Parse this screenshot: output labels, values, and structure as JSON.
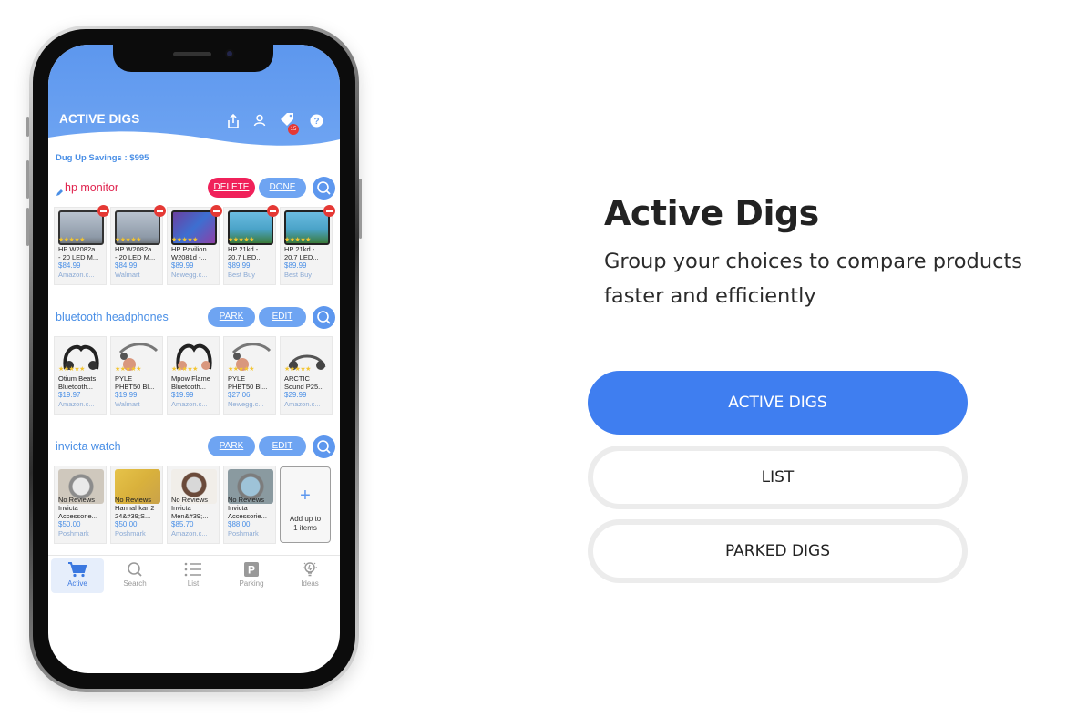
{
  "app": {
    "title": "ACTIVE DIGS",
    "notification_count": "15",
    "savings_text": "Dug Up Savings : $995"
  },
  "digs": [
    {
      "title": "hp monitor",
      "edit_icon": "pencil-icon",
      "buttons": [
        "DELETE",
        "DONE"
      ],
      "items": [
        {
          "name1": "HP W2082a",
          "name2": "- 20 LED M...",
          "price": "$84.99",
          "store": "Amazon.c..."
        },
        {
          "name1": "HP W2082a",
          "name2": "- 20 LED M...",
          "price": "$84.99",
          "store": "Walmart"
        },
        {
          "name1": "HP Pavilion",
          "name2": "W2081d -...",
          "price": "$89.99",
          "store": "Newegg.c..."
        },
        {
          "name1": "HP 21kd -",
          "name2": "20.7 LED...",
          "price": "$89.99",
          "store": "Best Buy"
        },
        {
          "name1": "HP 21kd -",
          "name2": "20.7 LED...",
          "price": "$89.99",
          "store": "Best Buy"
        }
      ]
    },
    {
      "title": "bluetooth headphones",
      "buttons": [
        "PARK",
        "EDIT"
      ],
      "items": [
        {
          "name1": "Otium Beats",
          "name2": "Bluetooth...",
          "price": "$19.97",
          "store": "Amazon.c..."
        },
        {
          "name1": "PYLE",
          "name2": "PHBT50 Bl...",
          "price": "$19.99",
          "store": "Walmart"
        },
        {
          "name1": "Mpow Flame",
          "name2": "Bluetooth...",
          "price": "$19.99",
          "store": "Amazon.c..."
        },
        {
          "name1": "PYLE",
          "name2": "PHBT50 Bl...",
          "price": "$27.06",
          "store": "Newegg.c..."
        },
        {
          "name1": "ARCTIC",
          "name2": "Sound P25...",
          "price": "$29.99",
          "store": "Amazon.c..."
        }
      ]
    },
    {
      "title": "invicta watch",
      "buttons": [
        "PARK",
        "EDIT"
      ],
      "items": [
        {
          "review": "No Reviews",
          "name1": "Invicta",
          "name2": "Accessorie...",
          "price": "$50.00",
          "store": "Poshmark"
        },
        {
          "review": "No Reviews",
          "name1": "Hannahkarr2",
          "name2": "24&#39;S...",
          "price": "$50.00",
          "store": "Poshmark"
        },
        {
          "review": "No Reviews",
          "name1": "Invicta",
          "name2": "Men&#39;...",
          "price": "$85.70",
          "store": "Amazon.c..."
        },
        {
          "review": "No Reviews",
          "name1": "Invicta",
          "name2": "Accessorie...",
          "price": "$88.00",
          "store": "Poshmark"
        }
      ],
      "add_card": {
        "plus": "+",
        "line1": "Add up to",
        "line2": "1 items"
      }
    }
  ],
  "tabs": [
    {
      "label": "Active",
      "icon": "cart-icon",
      "active": true
    },
    {
      "label": "Search",
      "icon": "search-icon",
      "active": false
    },
    {
      "label": "List",
      "icon": "list-icon",
      "active": false
    },
    {
      "label": "Parking",
      "icon": "parking-icon",
      "active": false
    },
    {
      "label": "Ideas",
      "icon": "lightbulb-icon",
      "active": false
    }
  ],
  "hero": {
    "title": "Active Digs",
    "subtitle": "Group your choices to compare products faster and efficiently"
  },
  "menu": [
    "ACTIVE DIGS",
    "LIST",
    "PARKED DIGS"
  ],
  "colors": {
    "primary_blue": "#3f7ef0",
    "header_blue": "#6ea4f2",
    "delete_red": "#f0215a",
    "star_yellow": "#f3c531"
  }
}
